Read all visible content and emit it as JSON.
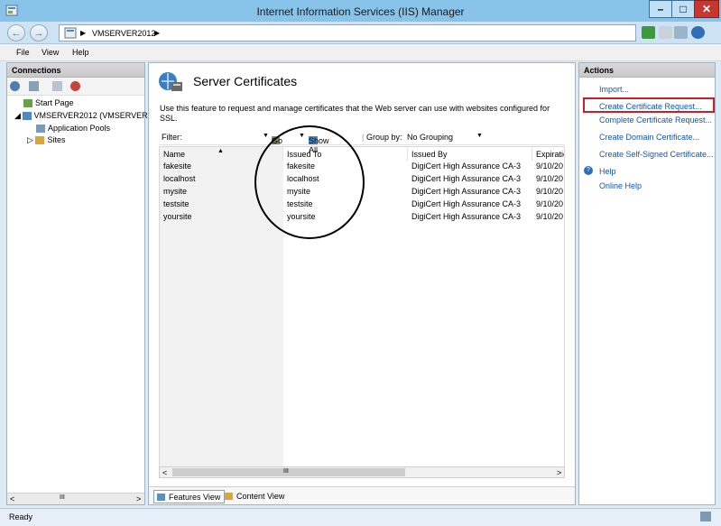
{
  "window": {
    "title": "Internet Information Services (IIS) Manager"
  },
  "address": {
    "crumbs": [
      "VMSERVER2012"
    ]
  },
  "menu": {
    "items": [
      "File",
      "View",
      "Help"
    ]
  },
  "connections": {
    "header": "Connections",
    "tree": [
      {
        "label": "Start Page"
      },
      {
        "label": "VMSERVER2012 (VMSERVER20"
      },
      {
        "label": "Application Pools"
      },
      {
        "label": "Sites"
      }
    ]
  },
  "center": {
    "title": "Server Certificates",
    "description": "Use this feature to request and manage certificates that the Web server can use with websites configured for SSL.",
    "filter": {
      "label": "Filter:",
      "go": "Go",
      "show_all": "Show All",
      "group_by_label": "Group by:",
      "group_by_value": "No Grouping"
    },
    "columns": [
      "Name",
      "Issued To",
      "Issued By",
      "Expiratic"
    ],
    "rows": [
      {
        "name": "fakesite",
        "issued_to": "fakesite",
        "issued_by": "DigiCert High Assurance CA-3",
        "expiration": "9/10/20"
      },
      {
        "name": "localhost",
        "issued_to": "localhost",
        "issued_by": "DigiCert High Assurance CA-3",
        "expiration": "9/10/20"
      },
      {
        "name": "mysite",
        "issued_to": "mysite",
        "issued_by": "DigiCert High Assurance CA-3",
        "expiration": "9/10/20"
      },
      {
        "name": "testsite",
        "issued_to": "testsite",
        "issued_by": "DigiCert High Assurance CA-3",
        "expiration": "9/10/20"
      },
      {
        "name": "yoursite",
        "issued_to": "yoursite",
        "issued_by": "DigiCert High Assurance CA-3",
        "expiration": "9/10/20"
      }
    ],
    "scroll_grip": "III",
    "tabs": [
      "Features View",
      "Content View"
    ]
  },
  "actions": {
    "header": "Actions",
    "items": [
      "Import...",
      "Create Certificate Request...",
      "Complete Certificate Request...",
      "Create Domain Certificate...",
      "Create Self-Signed Certificate...",
      "Help",
      "Online Help"
    ]
  },
  "status": {
    "text": "Ready"
  },
  "colors": {
    "link": "#1155b5",
    "highlight": "#c8202b",
    "titlebar": "#88c4ea"
  }
}
